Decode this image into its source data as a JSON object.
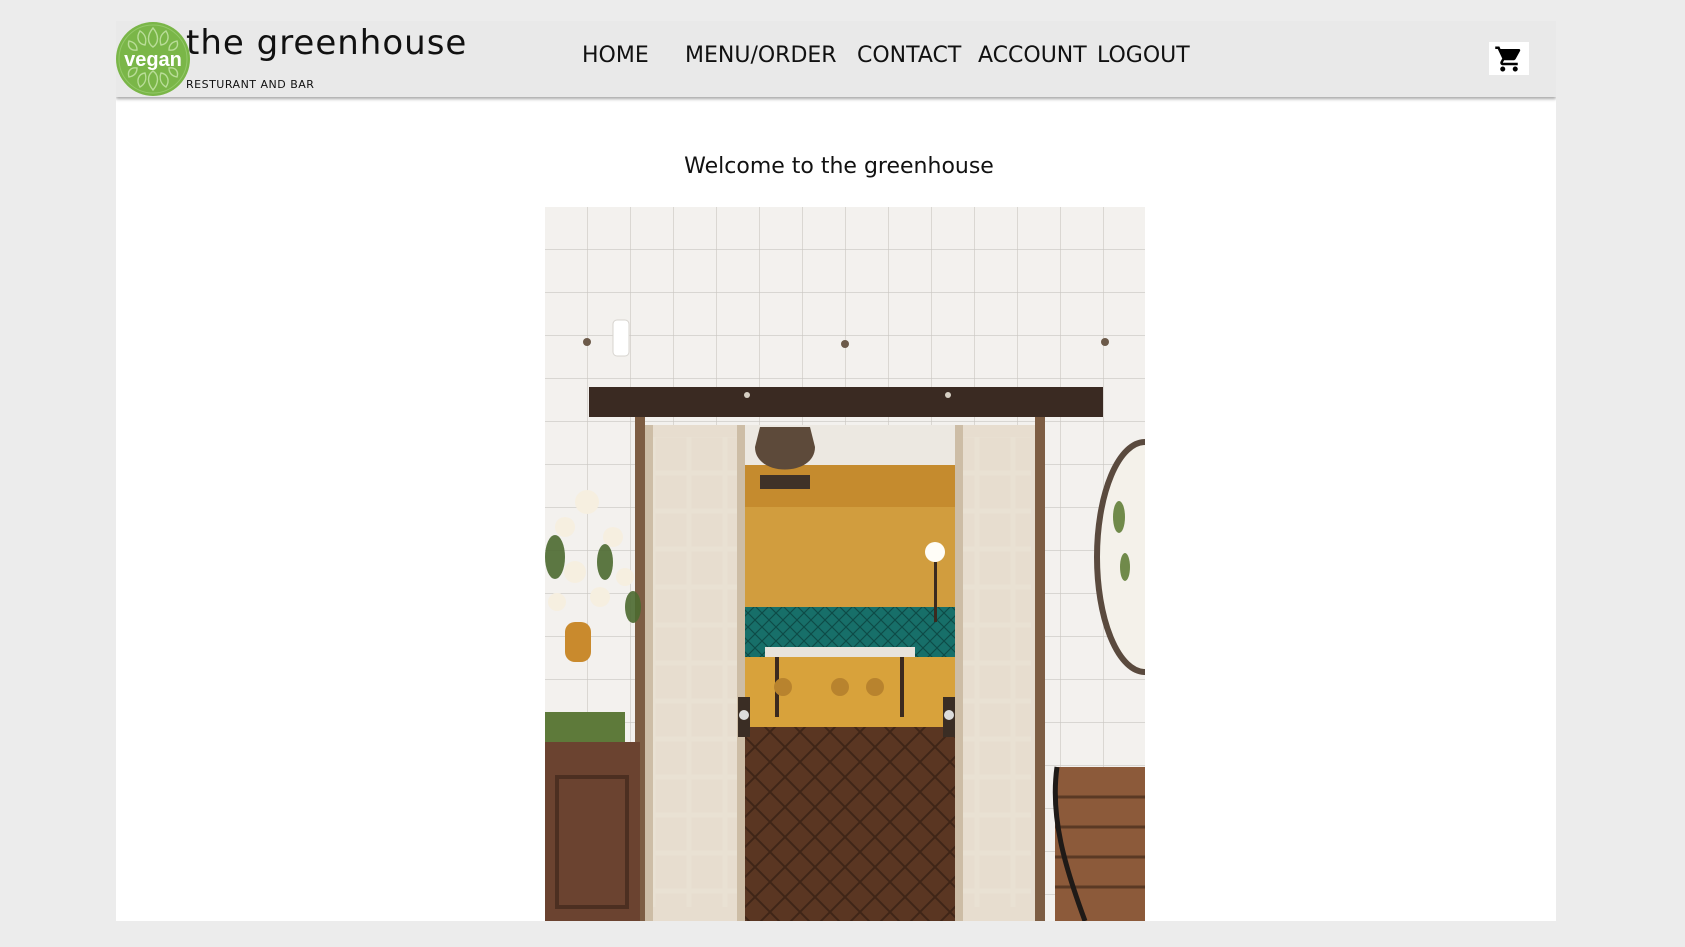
{
  "brand": {
    "logo_text": "vegan",
    "name": "the greenhouse",
    "tagline": "RESTURANT AND BAR",
    "logo_color": "#7ab648"
  },
  "nav": {
    "items": [
      {
        "label": "HOME"
      },
      {
        "label": "MENU/ORDER"
      },
      {
        "label": "CONTACT"
      },
      {
        "label": "ACCOUNT"
      },
      {
        "label": "LOGOUT"
      }
    ],
    "cart_icon": "shopping-cart-icon"
  },
  "main": {
    "welcome": "Welcome to the greenhouse"
  },
  "colors": {
    "background": "#ececec",
    "navbar": "#e9e9e9",
    "content": "#ffffff",
    "text": "#111111",
    "accent": "#7ab648"
  }
}
